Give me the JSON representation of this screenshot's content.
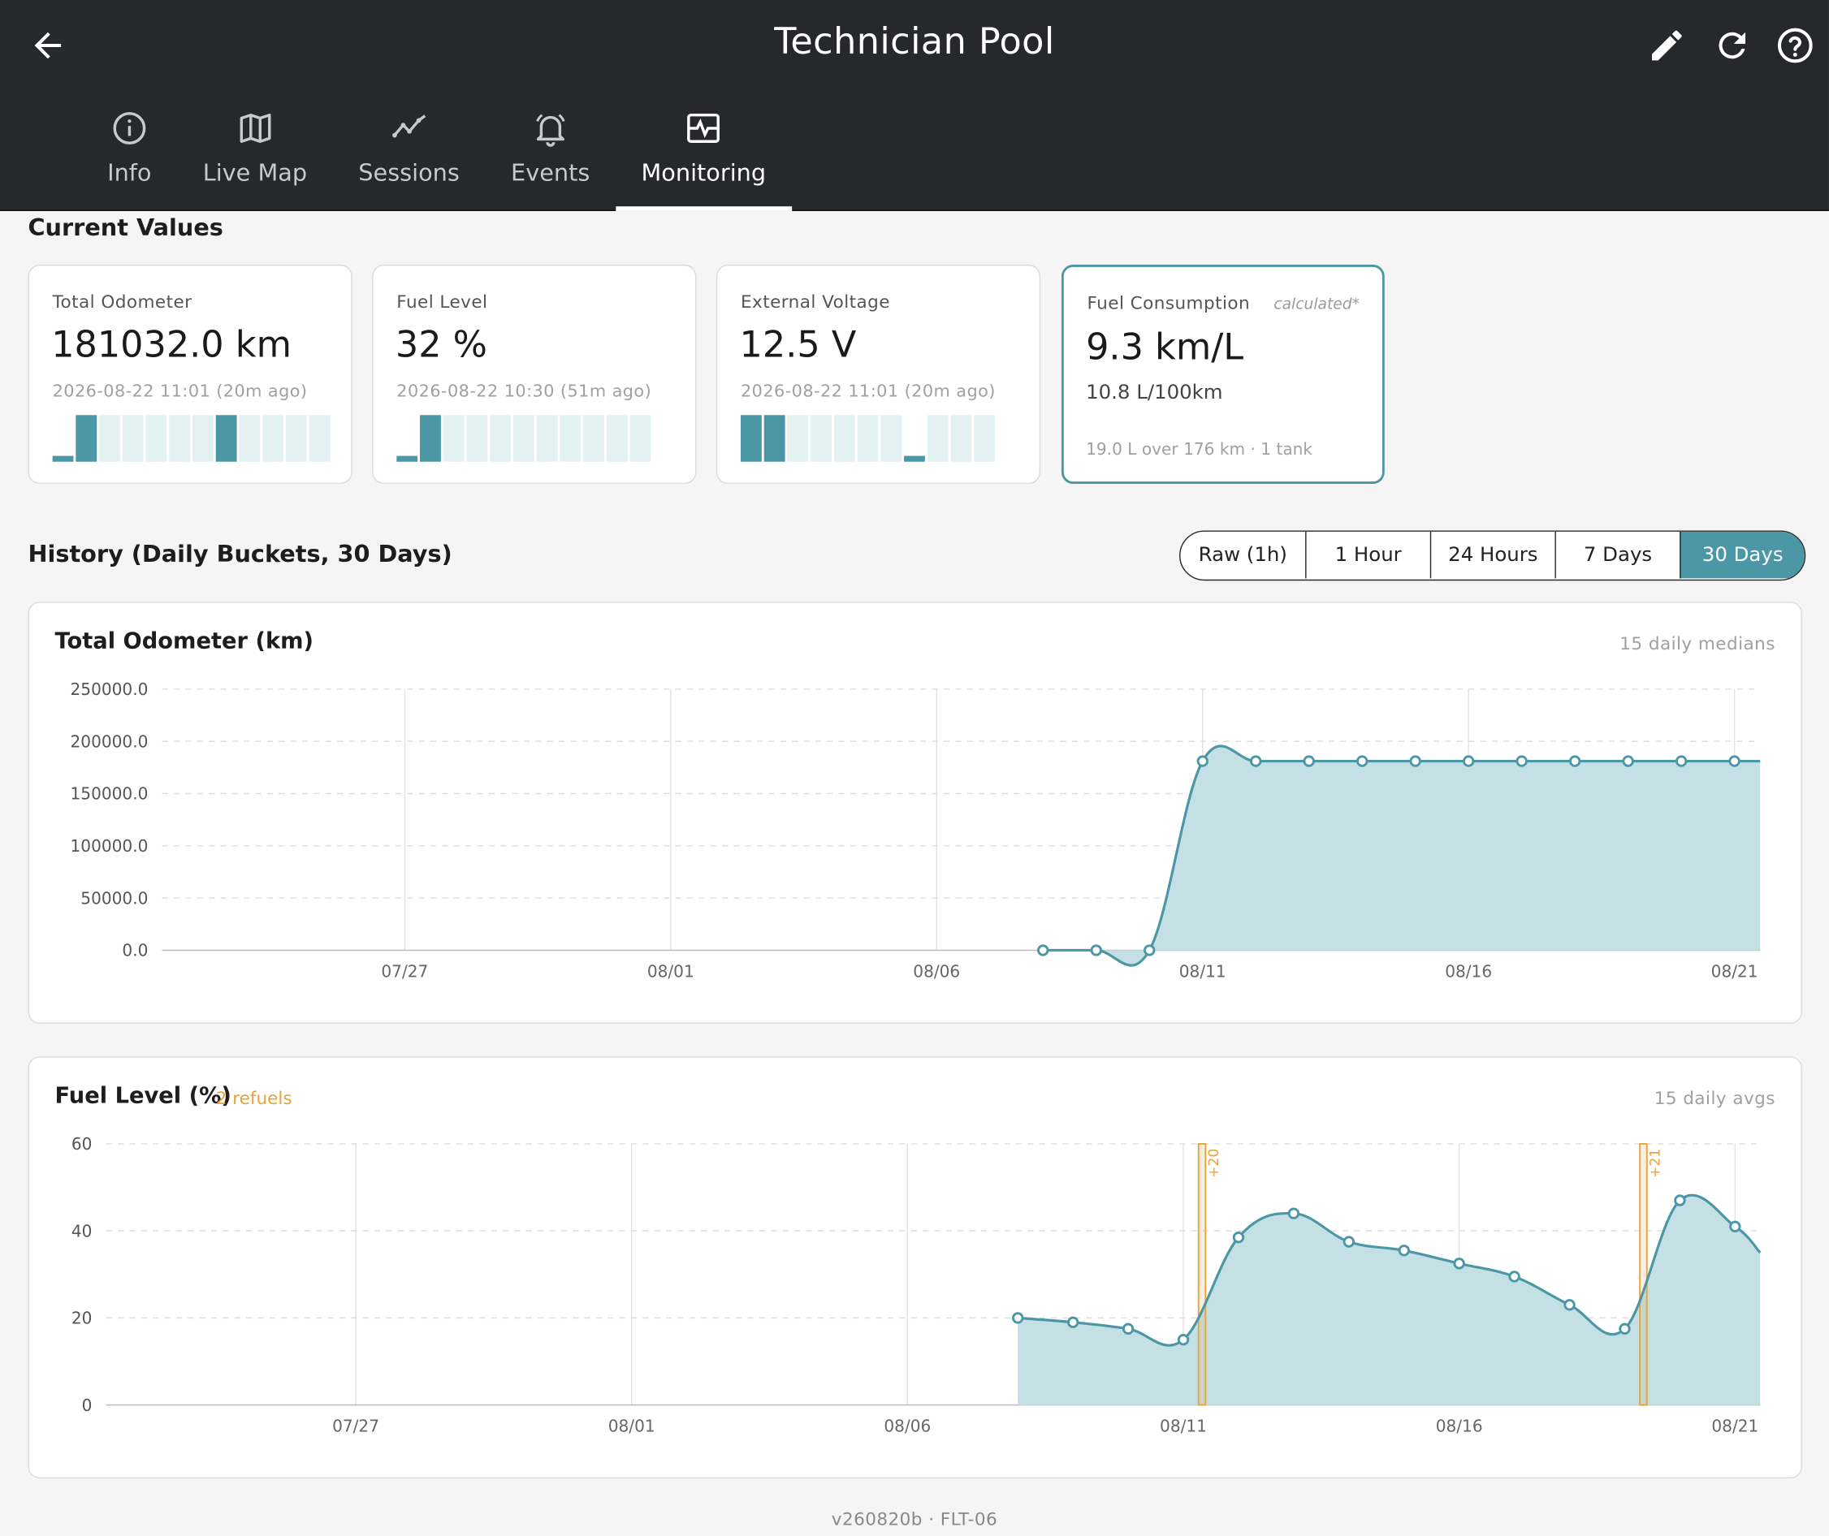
{
  "header": {
    "title": "Technician Pool",
    "tabs": [
      {
        "label": "Info",
        "icon": "info-icon"
      },
      {
        "label": "Live Map",
        "icon": "map-icon"
      },
      {
        "label": "Sessions",
        "icon": "trend-icon"
      },
      {
        "label": "Events",
        "icon": "bell-icon"
      },
      {
        "label": "Monitoring",
        "icon": "monitor-icon",
        "active": true
      }
    ]
  },
  "current": {
    "title": "Current Values",
    "cards": [
      {
        "label": "Total Odometer",
        "value": "181032.0 km",
        "time": "2026-08-22  11:01 (20m ago)"
      },
      {
        "label": "Fuel Level",
        "value": "32 %",
        "time": "2026-08-22  10:30 (51m ago)"
      },
      {
        "label": "External Voltage",
        "value": "12.5 V",
        "time": "2026-08-22  11:01 (20m ago)"
      }
    ],
    "consumption": {
      "label": "Fuel Consumption",
      "tag": "calculated*",
      "value": "9.3 km/L",
      "sub": "10.8 L/100km",
      "note": "19.0 L over 176 km · 1 tank"
    }
  },
  "history": {
    "title": "History (Daily Buckets, 30 Days)",
    "ranges": [
      "Raw (1h)",
      "1 Hour",
      "24 Hours",
      "7 Days",
      "30 Days"
    ],
    "active_range": "30 Days"
  },
  "colors": {
    "accent": "#4b97a6",
    "fill": "#c5e0e5",
    "refuel": "#e8a33b",
    "header": "#26282c"
  },
  "chart_data": [
    {
      "type": "area",
      "title": "Total Odometer (km)",
      "note": "15 daily medians",
      "x_ticks": [
        "07/27",
        "08/01",
        "08/06",
        "08/11",
        "08/16",
        "08/21"
      ],
      "y_ticks": [
        "250000.0",
        "200000.0",
        "150000.0",
        "100000.0",
        "50000.0",
        "0.0"
      ],
      "ylim": [
        0,
        250000
      ],
      "x": [
        "08/08",
        "08/09",
        "08/10",
        "08/11",
        "08/12",
        "08/13",
        "08/14",
        "08/15",
        "08/16",
        "08/17",
        "08/18",
        "08/19",
        "08/20",
        "08/21"
      ],
      "values": [
        0,
        0,
        0,
        181000,
        181000,
        181000,
        181000,
        181000,
        181000,
        181000,
        181000,
        181000,
        181000,
        181000
      ]
    },
    {
      "type": "area",
      "title": "Fuel Level (%)",
      "refuels_label": "2 refuels",
      "note": "15 daily avgs",
      "x_ticks": [
        "07/27",
        "08/01",
        "08/06",
        "08/11",
        "08/16",
        "08/21"
      ],
      "y_ticks": [
        "60",
        "40",
        "20",
        "0"
      ],
      "ylim": [
        0,
        60
      ],
      "x": [
        "08/08",
        "08/09",
        "08/10",
        "08/11",
        "08/12",
        "08/13",
        "08/14",
        "08/15",
        "08/16",
        "08/17",
        "08/18",
        "08/19",
        "08/20",
        "08/21"
      ],
      "values": [
        20,
        19,
        17.5,
        15,
        38.5,
        44,
        37.5,
        35.5,
        32.5,
        29.5,
        23,
        17.5,
        47,
        41
      ],
      "refuels": [
        {
          "date": "08/11",
          "label": "+20"
        },
        {
          "date": "08/19",
          "label": "+21"
        }
      ]
    }
  ],
  "footer": "v260820b · FLT-06"
}
